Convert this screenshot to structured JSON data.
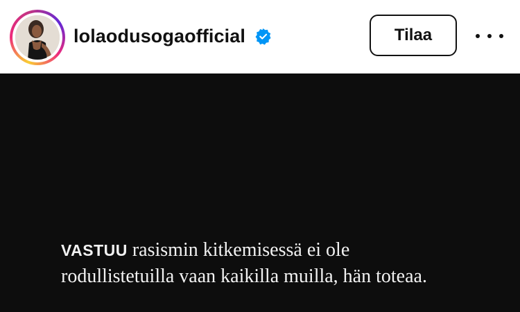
{
  "header": {
    "username": "lolaodusogaofficial",
    "verified_icon": "verified-badge-icon",
    "subscribe_label": "Tilaa",
    "more_icon": "more-options-icon",
    "avatar_ring_colors": [
      "#f9ce34",
      "#ee2a7b",
      "#c13584",
      "#6228d7"
    ]
  },
  "media": {
    "background": "#0d0d0d",
    "caption_lead": "VASTUU",
    "caption_rest": " rasismin kitkemisessä ei ole",
    "caption_line2": "rodullistetuilla vaan kaikilla muilla, hän toteaa."
  },
  "colors": {
    "verified_blue": "#0095f6",
    "text_primary": "#111111"
  }
}
